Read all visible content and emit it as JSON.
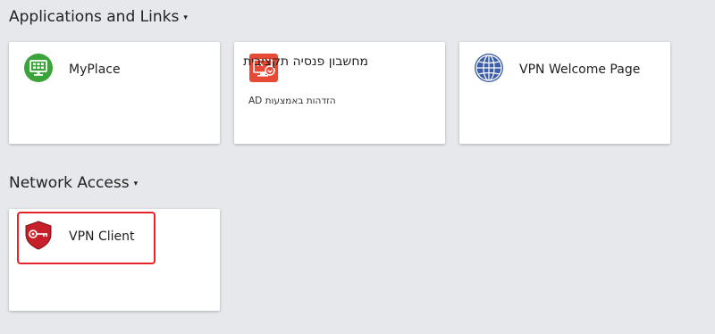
{
  "sections": {
    "applications": {
      "title": "Applications and Links",
      "caret": "▾"
    },
    "network": {
      "title": "Network Access",
      "caret": "▾"
    }
  },
  "tiles": {
    "myplace": {
      "label": "MyPlace",
      "icon": "desktop-grid-icon",
      "color": "#3aa43a"
    },
    "pension": {
      "label": "מחשבון פנסיה תקציבית",
      "description": "הזדהות באמצעות AD",
      "icon": "remote-desktop-icon",
      "color": "#e64a36"
    },
    "vpn_welcome": {
      "label": "VPN Welcome Page",
      "icon": "globe-icon",
      "color": "#3d5ea6"
    },
    "vpn_client": {
      "label": "VPN Client",
      "icon": "shield-key-icon",
      "color": "#c8202a"
    }
  },
  "highlight_color": "#e3242b"
}
